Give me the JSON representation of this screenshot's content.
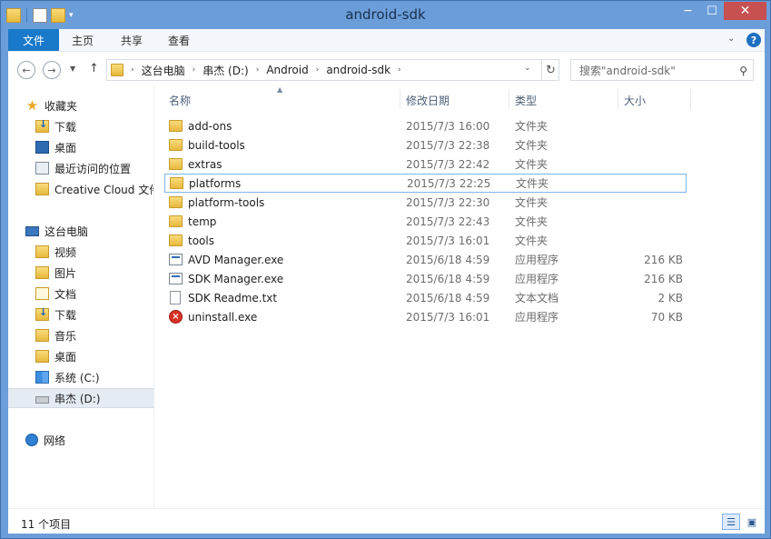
{
  "window": {
    "title": "android-sdk",
    "controls": {
      "minimize": "─",
      "maximize": "☐",
      "close": "✕"
    }
  },
  "ribbon": {
    "tabs": [
      "文件",
      "主页",
      "共享",
      "查看"
    ],
    "help": "?"
  },
  "address": {
    "breadcrumbs": [
      "这台电脑",
      "串杰 (D:)",
      "Android",
      "android-sdk"
    ],
    "search_placeholder": "搜索\"android-sdk\""
  },
  "nav_pane": {
    "favorites_label": "收藏夹",
    "favorites": [
      "下载",
      "桌面",
      "最近访问的位置",
      "Creative Cloud 文件"
    ],
    "pc_label": "这台电脑",
    "pc_items": [
      "视频",
      "图片",
      "文档",
      "下载",
      "音乐",
      "桌面",
      "系统 (C:)",
      "串杰 (D:)"
    ],
    "selected": "串杰 (D:)",
    "network_label": "网络"
  },
  "file_list": {
    "columns": [
      "名称",
      "修改日期",
      "类型",
      "大小"
    ],
    "rows": [
      {
        "name": "add-ons",
        "date": "2015/7/3 16:00",
        "type": "文件夹",
        "size": "",
        "icon": "folder-icon"
      },
      {
        "name": "build-tools",
        "date": "2015/7/3 22:38",
        "type": "文件夹",
        "size": "",
        "icon": "folder-icon"
      },
      {
        "name": "extras",
        "date": "2015/7/3 22:42",
        "type": "文件夹",
        "size": "",
        "icon": "folder-icon"
      },
      {
        "name": "platforms",
        "date": "2015/7/3 22:25",
        "type": "文件夹",
        "size": "",
        "icon": "folder-icon"
      },
      {
        "name": "platform-tools",
        "date": "2015/7/3 22:30",
        "type": "文件夹",
        "size": "",
        "icon": "folder-icon"
      },
      {
        "name": "temp",
        "date": "2015/7/3 22:43",
        "type": "文件夹",
        "size": "",
        "icon": "folder-icon"
      },
      {
        "name": "tools",
        "date": "2015/7/3 16:01",
        "type": "文件夹",
        "size": "",
        "icon": "folder-icon"
      },
      {
        "name": "AVD Manager.exe",
        "date": "2015/6/18 4:59",
        "type": "应用程序",
        "size": "216 KB",
        "icon": "exe-icon"
      },
      {
        "name": "SDK Manager.exe",
        "date": "2015/6/18 4:59",
        "type": "应用程序",
        "size": "216 KB",
        "icon": "exe-icon"
      },
      {
        "name": "SDK Readme.txt",
        "date": "2015/6/18 4:59",
        "type": "文本文档",
        "size": "2 KB",
        "icon": "text-file-icon"
      },
      {
        "name": "uninstall.exe",
        "date": "2015/7/3 16:01",
        "type": "应用程序",
        "size": "70 KB",
        "icon": "uninstall-icon"
      }
    ],
    "focused_row": "platforms"
  },
  "status": {
    "item_count": "11 个项目"
  },
  "colors": {
    "titlebar": "#6b9ed9",
    "file_tab": "#1979ca",
    "close_button": "#c75050",
    "focus_border": "#7eb4ea"
  }
}
